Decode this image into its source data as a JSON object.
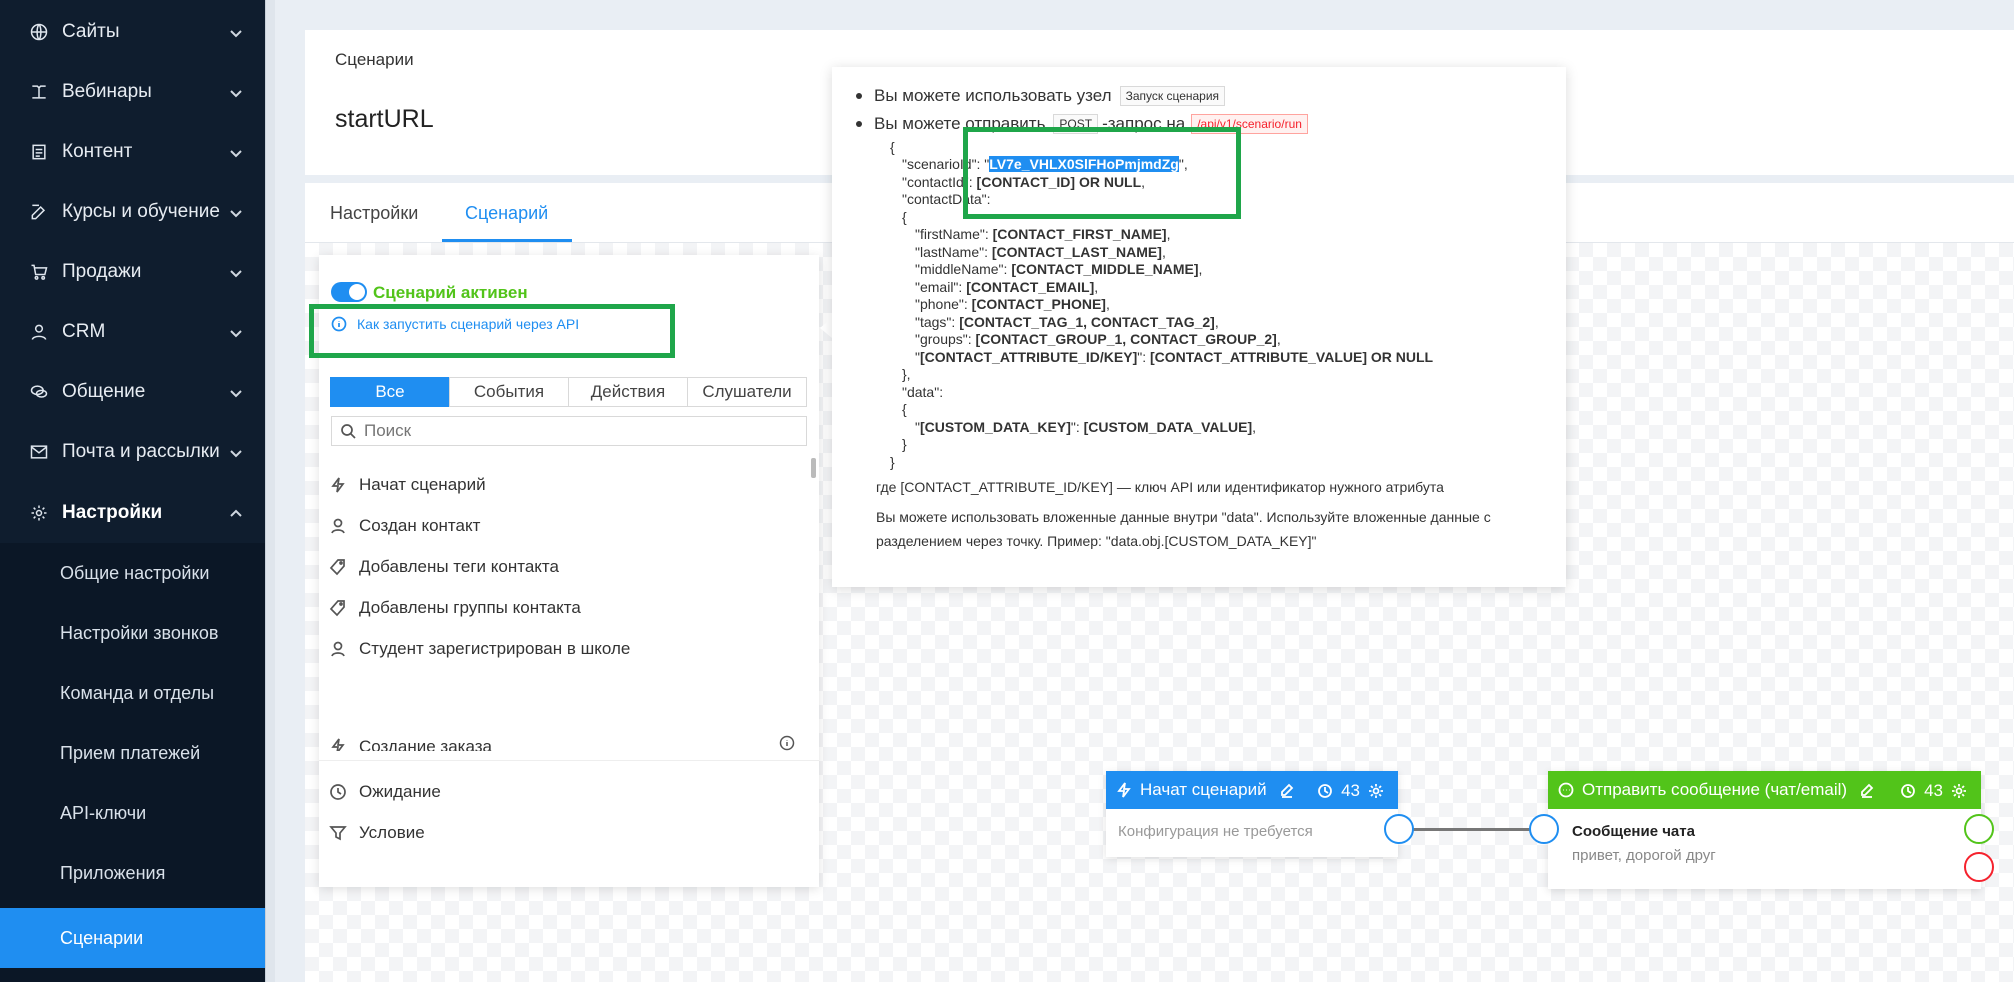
{
  "sidebar": {
    "items": [
      {
        "label": "Сайты",
        "icon": "globe-icon"
      },
      {
        "label": "Вебинары",
        "icon": "webinar-icon"
      },
      {
        "label": "Контент",
        "icon": "content-icon"
      },
      {
        "label": "Курсы и обучение",
        "icon": "edit-icon"
      },
      {
        "label": "Продажи",
        "icon": "cart-icon"
      },
      {
        "label": "CRM",
        "icon": "user-icon"
      },
      {
        "label": "Общение",
        "icon": "chat-icon"
      },
      {
        "label": "Почта и рассылки",
        "icon": "mail-icon"
      },
      {
        "label": "Настройки",
        "icon": "gear-icon"
      }
    ],
    "subitems": [
      {
        "label": "Общие настройки"
      },
      {
        "label": "Настройки звонков"
      },
      {
        "label": "Команда и отделы"
      },
      {
        "label": "Прием платежей"
      },
      {
        "label": "API-ключи"
      },
      {
        "label": "Приложения"
      },
      {
        "label": "Сценарии"
      }
    ],
    "active_color": "#1f8ef1"
  },
  "header": {
    "breadcrumb": "Сценарии",
    "title": "startURL"
  },
  "tabs": [
    {
      "label": "Настройки"
    },
    {
      "label": "Сценарий"
    }
  ],
  "panel": {
    "active_label": "Сценарий активен",
    "api_link": "Как запустить сценарий через API",
    "filters": [
      "Все",
      "События",
      "Действия",
      "Слушатели"
    ],
    "search_placeholder": "Поиск",
    "items": [
      {
        "label": "Начат сценарий",
        "icon": "lightning-icon"
      },
      {
        "label": "Создан контакт",
        "icon": "user-icon"
      },
      {
        "label": "Добавлены теги контакта",
        "icon": "tag-icon"
      },
      {
        "label": "Добавлены группы контакта",
        "icon": "tag-icon"
      },
      {
        "label": "Студент зарегистрирован в школе",
        "icon": "user-icon"
      },
      {
        "label": "Создание заказа",
        "icon": "lightning-icon"
      },
      {
        "label": "Ожидание",
        "icon": "clock-icon"
      },
      {
        "label": "Условие",
        "icon": "filter-icon"
      }
    ]
  },
  "popover": {
    "bullet1_text": "Вы можете использовать узел",
    "bullet1_tag": "Запуск сценария",
    "bullet2_text_a": "Вы можете отправить",
    "bullet2_tag": "POST",
    "bullet2_text_b": "-запрос на",
    "bullet2_url": "/api/v1/scenario/run",
    "code": {
      "open": "{",
      "scenario_key": "\"scenarioId\": \"",
      "scenario_val": "LV7e_VHLX0SlFHoPmjmdZg",
      "scenario_end": "\",",
      "contact_key": "\"contactId\": ",
      "contact_val": "[CONTACT_ID] OR NULL",
      "contact_data_key": "\"contactData\":",
      "fields": [
        {
          "key": "\"firstName\": ",
          "val": "[CONTACT_FIRST_NAME]"
        },
        {
          "key": "\"lastName\": ",
          "val": "[CONTACT_LAST_NAME]"
        },
        {
          "key": "\"middleName\": ",
          "val": "[CONTACT_MIDDLE_NAME]"
        },
        {
          "key": "\"email\": ",
          "val": "[CONTACT_EMAIL]"
        },
        {
          "key": "\"phone\": ",
          "val": "[CONTACT_PHONE]"
        },
        {
          "key": "\"tags\": ",
          "val": "[CONTACT_TAG_1, CONTACT_TAG_2]"
        },
        {
          "key": "\"groups\": ",
          "val": "[CONTACT_GROUP_1, CONTACT_GROUP_2]"
        }
      ],
      "attr_key": "[CONTACT_ATTRIBUTE_ID/KEY]",
      "attr_val": "[CONTACT_ATTRIBUTE_VALUE] OR NULL",
      "data_key": "\"data\":",
      "custom_key": "[CUSTOM_DATA_KEY]",
      "custom_val": "[CUSTOM_DATA_VALUE]"
    },
    "note1": "где [CONTACT_ATTRIBUTE_ID/KEY] — ключ API или идентификатор нужного атрибута",
    "note2": "Вы можете использовать вложенные данные внутри \"data\". Используйте вложенные данные с разделением через точку. Пример: \"data.obj.[CUSTOM_DATA_KEY]\""
  },
  "nodes": {
    "start": {
      "title": "Начат сценарий",
      "count": "43",
      "body": "Конфигурация не требуется",
      "color": "#1f8ef1"
    },
    "message": {
      "title": "Отправить сообщение (чат/email)",
      "count": "43",
      "body_title": "Сообщение чата",
      "body_text": "привет, дорогой друг",
      "color": "#52c41a"
    }
  }
}
